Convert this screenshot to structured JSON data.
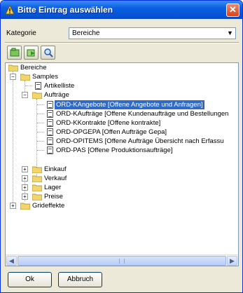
{
  "window": {
    "title": "Bitte Eintrag auswählen",
    "close_label": "✕"
  },
  "kategorie": {
    "label": "Kategorie",
    "value": "Bereiche"
  },
  "toolbar": {
    "buttons": [
      "expand-green-icon",
      "refresh-arrow-icon",
      "magnifier-icon"
    ]
  },
  "tree": {
    "root": "Bereiche",
    "samples": "Samples",
    "artikelliste": "Artikelliste",
    "auftraege": "Aufträge",
    "auftraege_items": [
      "ORD-KAngebote [Offene Angebote und Anfragen]",
      "ORD-KAufträge [Offene Kundenaufträge und Bestellungen",
      "ORD-KKontrakte [Offene kontrakte]",
      "ORD-OPGEPA [Offen Aufträge Gepa]",
      "ORD-OPITEMS [Offene Aufträge Übersicht nach Erfassu",
      "ORD-PAS [Offene Produktionsaufträge]"
    ],
    "selected_index": 0,
    "einkauf": "Einkauf",
    "verkauf": "Verkauf",
    "lager": "Lager",
    "preise": "Preise",
    "grideffekte": "Grideffekte"
  },
  "buttons": {
    "ok": "Ok",
    "abbruch": "Abbruch"
  },
  "colors": {
    "title_bar": "#0553d4",
    "selection": "#316ac5",
    "folder": "#f2d56b"
  }
}
